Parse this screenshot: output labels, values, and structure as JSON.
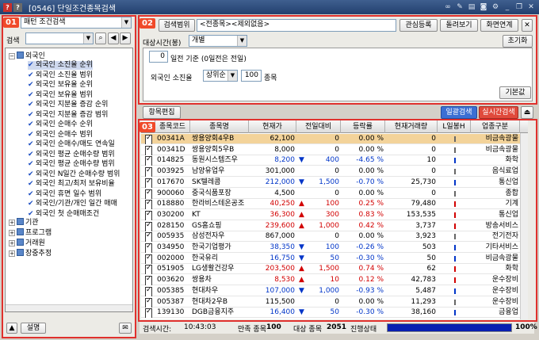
{
  "window": {
    "title": "[0546] 단일조건종목검색",
    "icons": {
      "help": "question-icon",
      "fav": "star-icon"
    },
    "right_icons": [
      "link-icon",
      "palette-icon",
      "print-icon",
      "camera-icon",
      "config-icon",
      "minimize-icon",
      "restore-icon",
      "close-icon"
    ]
  },
  "left": {
    "badge": "01",
    "preset": "패턴 조건검색",
    "search_label": "검색",
    "tree": {
      "root": "외국인",
      "items": [
        "외국인 소진율 순위",
        "외국인 소진율 범위",
        "외국인 보유율 순위",
        "외국인 보유율 범위",
        "외국인 지분율 증감 순위",
        "외국인 지분율 증감 범위",
        "외국인 순매수 순위",
        "외국인 순매수 범위",
        "외국인 순매수/매도 연속일",
        "외국인 평균 순매수량 범위",
        "외국인 평균 순매수량 범위",
        "외국인 N일간 순매수량 범위",
        "외국인 최고/최저 보유비율",
        "외국인 휴면 일수 범위",
        "외국인/기관/개인 일간 매매",
        "외국인 첫 순매매조건"
      ],
      "folders": [
        "기관",
        "프로그램",
        "거래원",
        "장중추정"
      ]
    },
    "bottom": {
      "desc_label": "설명"
    }
  },
  "top": {
    "badge": "02",
    "range_btn": "검색범위",
    "range_value": "<전종목><제외없음>",
    "btn_fav": "관심등록",
    "btn_browse": "돌려보기",
    "btn_link": "화면연계",
    "time_label": "대상시간(봉)",
    "time_value": "개별",
    "reset": "초기화",
    "day_value": "0",
    "day_text": "일전 기준 (0일전은 전일)",
    "cond_label": "외국인 소진율",
    "cond_select": "상위순",
    "cond_count": "100",
    "cond_unit": "종목",
    "default_btn": "기본값"
  },
  "mid": {
    "edit_btn": "항목편집",
    "bulk_btn": "일괄검색",
    "real_btn": "실시간검색"
  },
  "grid": {
    "badge": "03",
    "columns": [
      "종목코드",
      "종목명",
      "현재가",
      "전일대비",
      "등락률",
      "현재거래량",
      "L일봉H",
      "업종구분"
    ],
    "rows": [
      {
        "code": "00341A",
        "name": "쌍용양회4우B",
        "price": "62,100",
        "dir": "",
        "chg": "0",
        "rate": "0.00 %",
        "vol": "0",
        "sector": "비금속광물",
        "sel": true
      },
      {
        "code": "00341D",
        "name": "쌍용양회5우B",
        "price": "8,000",
        "dir": "",
        "chg": "0",
        "rate": "0.00 %",
        "vol": "0",
        "sector": "비금속광물"
      },
      {
        "code": "014825",
        "name": "동원시스템즈우",
        "price": "8,200",
        "dir": "dn",
        "chg": "400",
        "rate": "-4.65 %",
        "vol": "10",
        "sector": "화학"
      },
      {
        "code": "003925",
        "name": "남양유업우",
        "price": "301,000",
        "dir": "",
        "chg": "0",
        "rate": "0.00 %",
        "vol": "0",
        "sector": "음식료업"
      },
      {
        "code": "017670",
        "name": "SK텔레콤",
        "price": "212,000",
        "dir": "dn",
        "chg": "1,500",
        "rate": "-0.70 %",
        "vol": "25,730",
        "sector": "통신업"
      },
      {
        "code": "900060",
        "name": "중국식품포장",
        "price": "4,500",
        "dir": "",
        "chg": "0",
        "rate": "0.00 %",
        "vol": "0",
        "sector": "종합"
      },
      {
        "code": "018880",
        "name": "한라비스테온공조",
        "price": "40,250",
        "dir": "up",
        "chg": "100",
        "rate": "0.25 %",
        "vol": "79,480",
        "sector": "기계"
      },
      {
        "code": "030200",
        "name": "KT",
        "price": "36,300",
        "dir": "up",
        "chg": "300",
        "rate": "0.83 %",
        "vol": "153,535",
        "sector": "통신업"
      },
      {
        "code": "028150",
        "name": "GS홈쇼핑",
        "price": "239,600",
        "dir": "up",
        "chg": "1,000",
        "rate": "0.42 %",
        "vol": "3,737",
        "sector": "방송서비스"
      },
      {
        "code": "005935",
        "name": "삼성전자우",
        "price": "867,000",
        "dir": "",
        "chg": "0",
        "rate": "0.00 %",
        "vol": "3,923",
        "sector": "전기전자"
      },
      {
        "code": "034950",
        "name": "한국기업평가",
        "price": "38,350",
        "dir": "dn",
        "chg": "100",
        "rate": "-0.26 %",
        "vol": "503",
        "sector": "기타서비스"
      },
      {
        "code": "002000",
        "name": "한국유리",
        "price": "16,750",
        "dir": "dn",
        "chg": "50",
        "rate": "-0.30 %",
        "vol": "50",
        "sector": "비금속광물"
      },
      {
        "code": "051905",
        "name": "LG생활건강우",
        "price": "203,500",
        "dir": "up",
        "chg": "1,500",
        "rate": "0.74 %",
        "vol": "62",
        "sector": "화학"
      },
      {
        "code": "003620",
        "name": "쌍용차",
        "price": "8,530",
        "dir": "up",
        "chg": "10",
        "rate": "0.12 %",
        "vol": "42,783",
        "sector": "운수장비"
      },
      {
        "code": "005385",
        "name": "현대차우",
        "price": "107,000",
        "dir": "dn",
        "chg": "1,000",
        "rate": "-0.93 %",
        "vol": "5,487",
        "sector": "운수장비"
      },
      {
        "code": "005387",
        "name": "현대차2우B",
        "price": "115,500",
        "dir": "",
        "chg": "0",
        "rate": "0.00 %",
        "vol": "11,293",
        "sector": "운수장비"
      },
      {
        "code": "139130",
        "name": "DGB금융지주",
        "price": "16,400",
        "dir": "dn",
        "chg": "50",
        "rate": "-0.30 %",
        "vol": "38,160",
        "sector": "금융업"
      }
    ]
  },
  "status": {
    "time_label": "검색시간:",
    "time": "10:43:03",
    "full_label": "만족 종목",
    "full": "100",
    "target_label": "대상 종목",
    "target": "2051",
    "progress_label": "진행상태",
    "progress": "100%",
    "progress_fraction": 1.0
  },
  "colors": {
    "accent": "#e0312d",
    "up": "#d20000",
    "down": "#0035c8",
    "progress": "#0a1fb0"
  }
}
